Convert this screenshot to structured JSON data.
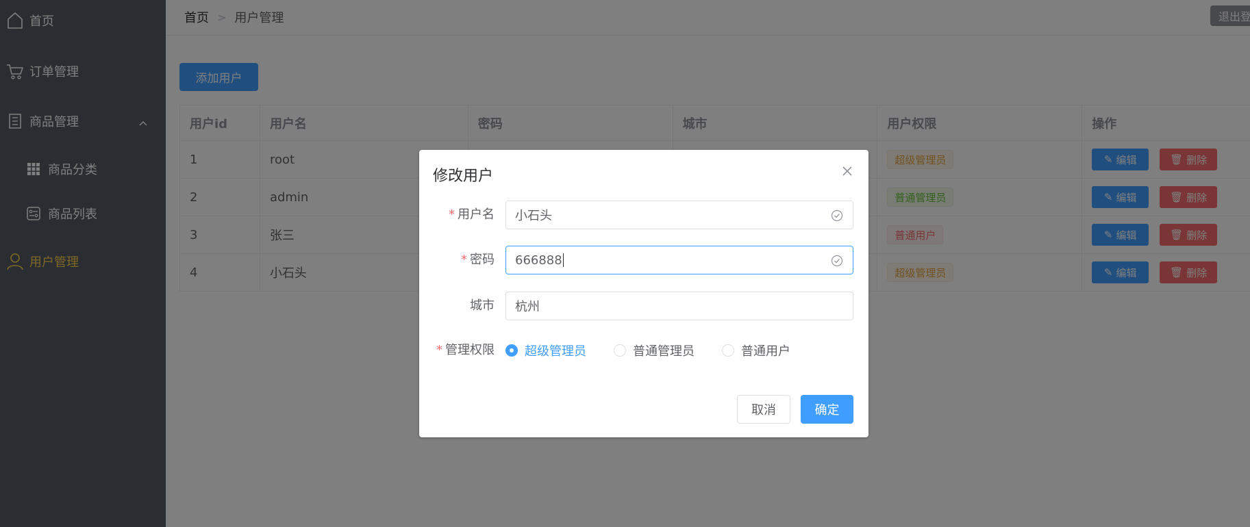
{
  "sidebar": {
    "items": [
      {
        "label": "首页",
        "icon": "home-icon"
      },
      {
        "label": "订单管理",
        "icon": "cart-icon"
      },
      {
        "label": "商品管理",
        "icon": "document-icon",
        "expanded": true
      },
      {
        "label": "商品分类",
        "icon": "grid-icon"
      },
      {
        "label": "商品列表",
        "icon": "list-icon"
      },
      {
        "label": "用户管理",
        "icon": "user-icon",
        "active": true
      }
    ]
  },
  "header": {
    "breadcrumb": [
      "首页",
      "用户管理"
    ],
    "logout_label": "退出登录"
  },
  "main": {
    "add_user_label": "添加用户"
  },
  "table": {
    "headers": [
      "用户id",
      "用户名",
      "密码",
      "城市",
      "用户权限",
      "操作"
    ],
    "rows": [
      {
        "id": "1",
        "username": "root",
        "role": "超级管理员",
        "role_type": "warning"
      },
      {
        "id": "2",
        "username": "admin",
        "role": "普通管理员",
        "role_type": "success"
      },
      {
        "id": "3",
        "username": "张三",
        "role": "普通用户",
        "role_type": "danger"
      },
      {
        "id": "4",
        "username": "小石头",
        "role": "超级管理员",
        "role_type": "warning"
      }
    ],
    "edit_label": "编辑",
    "delete_label": "删除"
  },
  "dialog": {
    "title": "修改用户",
    "fields": {
      "username": {
        "label": "用户名",
        "value": "小石头",
        "required": true
      },
      "password": {
        "label": "密码",
        "value": "666888",
        "required": true
      },
      "city": {
        "label": "城市",
        "value": "杭州",
        "required": false
      },
      "role": {
        "label": "管理权限",
        "required": true,
        "options": [
          "超级管理员",
          "普通管理员",
          "普通用户"
        ],
        "selected": "超级管理员"
      }
    },
    "cancel_label": "取消",
    "confirm_label": "确定"
  },
  "colors": {
    "primary": "#409eff",
    "sidebar_bg": "#545c64",
    "sidebar_active": "#ffd04b",
    "danger": "#f56c6c",
    "warning": "#e6a23c",
    "success": "#67c23a"
  }
}
